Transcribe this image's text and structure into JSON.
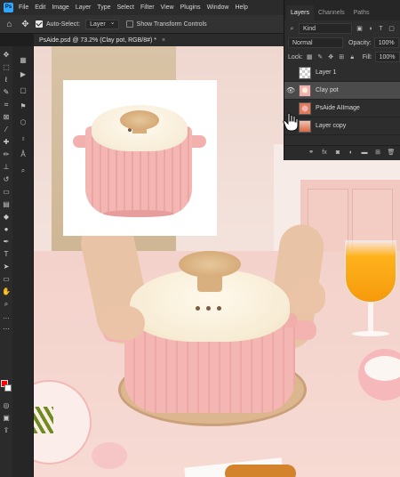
{
  "app": {
    "logo": "Ps",
    "menu": [
      "File",
      "Edit",
      "Image",
      "Layer",
      "Type",
      "Select",
      "Filter",
      "View",
      "Plugins",
      "Window",
      "Help"
    ]
  },
  "options_bar": {
    "home_icon": "home-icon",
    "move_icon": "move-tool-icon",
    "auto_select_label": "Auto-Select:",
    "auto_select_checked": true,
    "auto_select_value": "Layer",
    "show_transform_label": "Show Transform Controls",
    "show_transform_checked": false
  },
  "document": {
    "tab_title": "PsAide.psd @ 73.2% (Clay pot, RGB/8#) *",
    "close": "×"
  },
  "layers_panel": {
    "tabs": [
      {
        "label": "Layers",
        "active": true
      },
      {
        "label": "Channels",
        "active": false
      },
      {
        "label": "Paths",
        "active": false
      }
    ],
    "filter_kind": "Kind",
    "blend_mode": "Normal",
    "opacity_label": "Opacity:",
    "opacity_value": "100%",
    "lock_label": "Lock:",
    "fill_label": "Fill:",
    "fill_value": "100%",
    "layers": [
      {
        "name": "Layer 1",
        "visible": false,
        "selected": false,
        "thumb": "transparent"
      },
      {
        "name": "Clay pot",
        "visible": true,
        "selected": true,
        "thumb": "pot"
      },
      {
        "name": "PsAide AIImage",
        "visible": false,
        "selected": false,
        "thumb": "ai"
      },
      {
        "name": "Layer copy",
        "visible": false,
        "selected": false,
        "thumb": "copy"
      }
    ],
    "footer_icons": [
      "link-icon",
      "fx-icon",
      "mask-icon",
      "adjustment-icon",
      "folder-icon",
      "new-layer-icon",
      "trash-icon"
    ]
  },
  "colors": {
    "accent": "#31a8ff",
    "foreground": "#ff0000",
    "background": "#ffffff",
    "panel_bg": "#2d2d2d",
    "selected_layer": "#4b4b4b"
  }
}
